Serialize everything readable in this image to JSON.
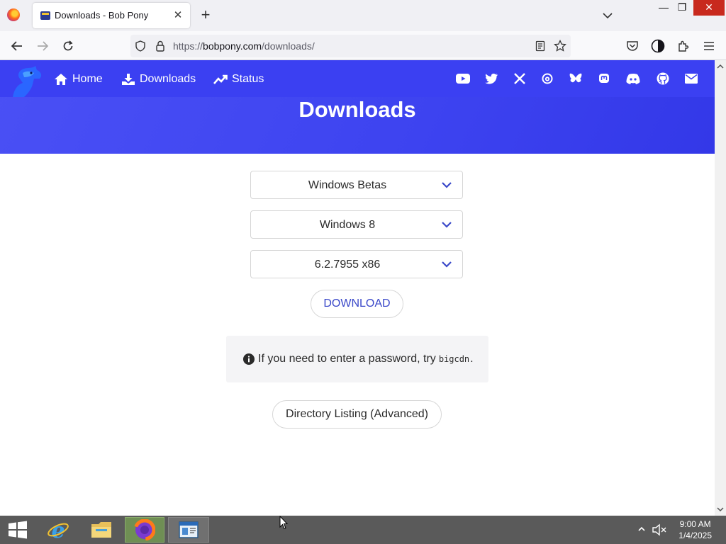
{
  "browser": {
    "tab_title": "Downloads - Bob Pony",
    "url_prefix": "https://",
    "url_host": "bobpony.com",
    "url_path": "/downloads/"
  },
  "site_nav": {
    "links": [
      {
        "label": "Home",
        "icon": "home-icon"
      },
      {
        "label": "Downloads",
        "icon": "download-icon"
      },
      {
        "label": "Status",
        "icon": "trend-icon"
      }
    ],
    "social_icons": [
      "youtube-icon",
      "twitter-icon",
      "x-icon",
      "threads-icon",
      "bluesky-icon",
      "mastodon-icon",
      "discord-icon",
      "github-icon",
      "mail-icon"
    ]
  },
  "hero": {
    "title": "Downloads"
  },
  "form": {
    "category_value": "Windows Betas",
    "product_value": "Windows 8",
    "build_value": "6.2.7955 x86",
    "download_label": "DOWNLOAD"
  },
  "notice": {
    "text_before": "If you need to enter a password, try",
    "code": "bigcdn",
    "text_after": "."
  },
  "directory_button": "Directory Listing (Advanced)",
  "taskbar": {
    "time": "9:00 AM",
    "date": "1/4/2025"
  },
  "colors": {
    "hero": "#3b40f2",
    "accent_link": "#3a48c9",
    "close_button": "#c8291d"
  }
}
